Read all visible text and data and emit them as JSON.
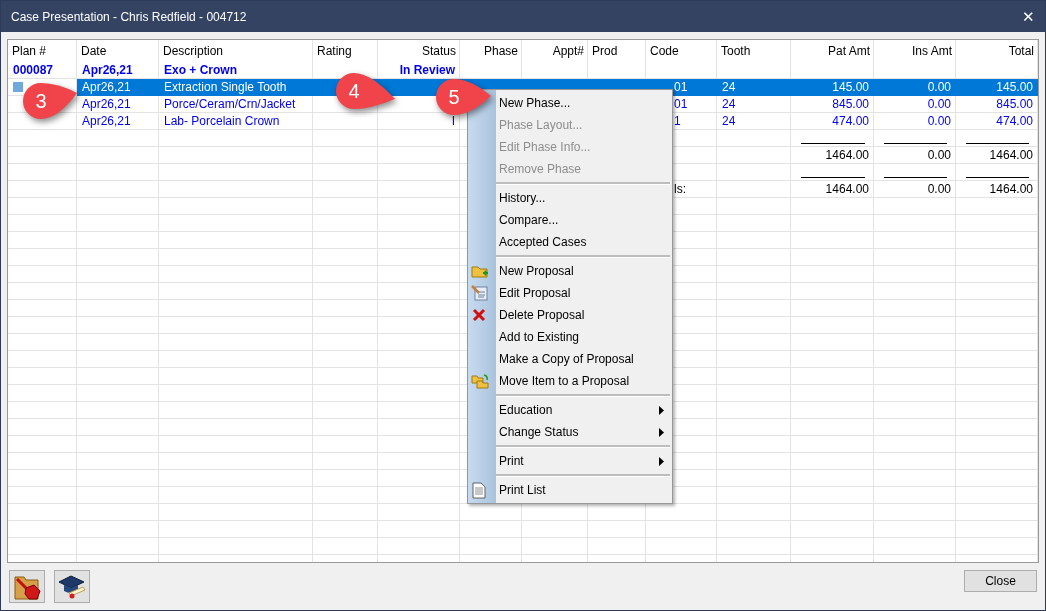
{
  "window": {
    "title": "Case Presentation - Chris Redfield - 004712",
    "close": "✕"
  },
  "table": {
    "columns": [
      "Plan #",
      "Date",
      "Description",
      "Rating",
      "Status",
      "Phase",
      "Appt#",
      "Prod",
      "Code",
      "Tooth",
      "Pat Amt",
      "Ins Amt",
      "Total"
    ],
    "rows": [
      {
        "kind": "plan",
        "selected": false,
        "plan": "000087",
        "date": "Apr26,21",
        "description": "Exo + Crown",
        "status": "In Review"
      },
      {
        "kind": "item",
        "selected": true,
        "date": "Apr26,21",
        "description": "Extraction Single Tooth",
        "code": "01",
        "tooth": "24",
        "pat_amt": "145.00",
        "ins_amt": "0.00",
        "total": "145.00"
      },
      {
        "kind": "item",
        "selected": false,
        "date": "Apr26,21",
        "description": "Porce/Ceram/Crn/Jacket",
        "code": "01",
        "tooth": "24",
        "pat_amt": "845.00",
        "ins_amt": "0.00",
        "total": "845.00"
      },
      {
        "kind": "item",
        "selected": false,
        "date": "Apr26,21",
        "description": "Lab- Porcelain Crown",
        "status": "I",
        "code": "1",
        "tooth": "24",
        "pat_amt": "474.00",
        "ins_amt": "0.00",
        "total": "474.00"
      },
      {
        "kind": "rule"
      },
      {
        "kind": "total",
        "pat_amt": "1464.00",
        "ins_amt": "0.00",
        "total": "1464.00"
      },
      {
        "kind": "rule"
      },
      {
        "kind": "total",
        "code": "ls:",
        "pat_amt": "1464.00",
        "ins_amt": "0.00",
        "total": "1464.00"
      }
    ]
  },
  "context_menu": {
    "groups": [
      [
        {
          "label": "New Phase...",
          "disabled": false,
          "has_icon": false,
          "submenu": false
        },
        {
          "label": "Phase Layout...",
          "disabled": true,
          "has_icon": false,
          "submenu": false
        },
        {
          "label": "Edit Phase Info...",
          "disabled": true,
          "has_icon": false,
          "submenu": false
        },
        {
          "label": "Remove Phase",
          "disabled": true,
          "has_icon": false,
          "submenu": false
        }
      ],
      [
        {
          "label": "History...",
          "disabled": false,
          "has_icon": false,
          "submenu": false
        },
        {
          "label": "Compare...",
          "disabled": false,
          "has_icon": false,
          "submenu": false
        },
        {
          "label": "Accepted Cases",
          "disabled": false,
          "has_icon": false,
          "submenu": false
        }
      ],
      [
        {
          "label": "New Proposal",
          "disabled": false,
          "has_icon": true,
          "submenu": false
        },
        {
          "label": "Edit Proposal",
          "disabled": false,
          "has_icon": true,
          "submenu": false
        },
        {
          "label": "Delete Proposal",
          "disabled": false,
          "has_icon": true,
          "submenu": false
        },
        {
          "label": "Add to Existing",
          "disabled": false,
          "has_icon": false,
          "submenu": false
        },
        {
          "label": "Make a Copy of Proposal",
          "disabled": false,
          "has_icon": false,
          "submenu": false
        },
        {
          "label": "Move Item to a Proposal",
          "disabled": false,
          "has_icon": true,
          "submenu": false
        }
      ],
      [
        {
          "label": "Education",
          "disabled": false,
          "has_icon": false,
          "submenu": true
        },
        {
          "label": "Change Status",
          "disabled": false,
          "has_icon": false,
          "submenu": true
        }
      ],
      [
        {
          "label": "Print",
          "disabled": false,
          "has_icon": false,
          "submenu": true
        }
      ],
      [
        {
          "label": "Print List",
          "disabled": false,
          "has_icon": true,
          "submenu": false
        }
      ]
    ]
  },
  "callouts": [
    {
      "number": "3"
    },
    {
      "number": "4"
    },
    {
      "number": "5"
    }
  ],
  "footer": {
    "close_button": "Close"
  }
}
